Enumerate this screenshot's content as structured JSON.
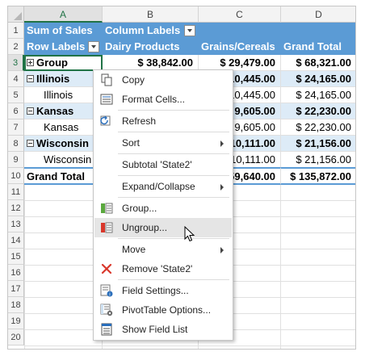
{
  "columns": [
    "A",
    "B",
    "C",
    "D"
  ],
  "rows": [
    "1",
    "2",
    "3",
    "4",
    "5",
    "6",
    "7",
    "8",
    "9",
    "10",
    "11",
    "12",
    "13",
    "14",
    "15",
    "16",
    "17",
    "18",
    "19",
    "20"
  ],
  "pivot": {
    "r1": {
      "a": "Sum of Sales",
      "b": "Column Labels"
    },
    "r2": {
      "a": "Row Labels",
      "b": "Dairy Products",
      "c": "Grains/Cereals",
      "d": "Grand Total"
    },
    "r3": {
      "a": "Group",
      "b": "$ 38,842.00",
      "c": "$ 29,479.00",
      "d": "$ 68,321.00"
    },
    "r4": {
      "a": "Illinois",
      "c": "10,445.00",
      "d": "$ 24,165.00"
    },
    "r5": {
      "a": "Illinois",
      "c": "10,445.00",
      "d": "$ 24,165.00"
    },
    "r6": {
      "a": "Kansas",
      "c": "9,605.00",
      "d": "$ 22,230.00"
    },
    "r7": {
      "a": "Kansas",
      "c": "9,605.00",
      "d": "$ 22,230.00"
    },
    "r8": {
      "a": "Wisconsin",
      "c": "10,111.00",
      "d": "$ 21,156.00"
    },
    "r9": {
      "a": "Wisconsin",
      "c": "10,111.00",
      "d": "$ 21,156.00"
    },
    "r10": {
      "a": "Grand Total",
      "c": "59,640.00",
      "d": "$ 135,872.00"
    }
  },
  "menu": {
    "copy": "Copy",
    "format_cells": "Format Cells...",
    "refresh": "Refresh",
    "sort": "Sort",
    "subtotal": "Subtotal 'State2'",
    "expand_collapse": "Expand/Collapse",
    "group": "Group...",
    "ungroup": "Ungroup...",
    "move": "Move",
    "remove": "Remove 'State2'",
    "field_settings": "Field Settings...",
    "pivot_options": "PivotTable Options...",
    "show_field_list": "Show Field List"
  },
  "colors": {
    "header_blue": "#5b9bd5",
    "light_blue": "#ddebf7",
    "excel_green": "#217346",
    "remove_red": "#d9372b"
  }
}
